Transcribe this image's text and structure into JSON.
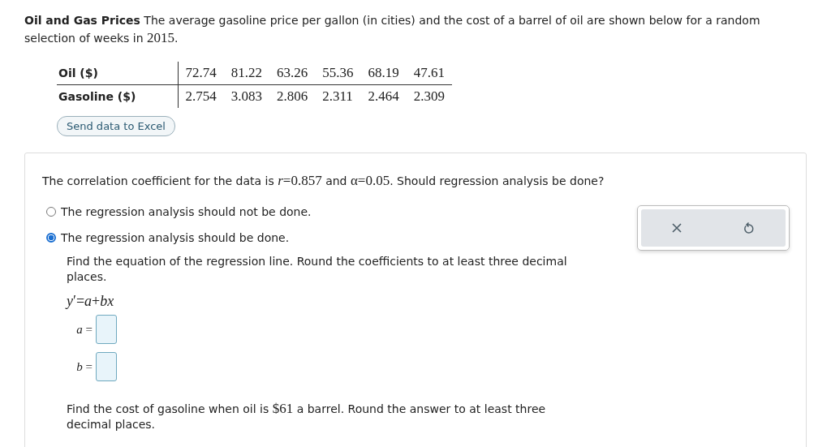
{
  "intro": [
    {
      "kind": "bold",
      "text": "Oil and Gas Prices"
    },
    {
      "kind": "text",
      "text": " The average gasoline price per gallon (in cities) and the cost of a barrel of oil are shown below for a random selection of weeks in "
    },
    {
      "kind": "math",
      "text": "2015"
    },
    {
      "kind": "text",
      "text": "."
    }
  ],
  "table": {
    "rows": [
      {
        "label": "Oil ($)",
        "values": [
          "72.74",
          "81.22",
          "63.26",
          "55.36",
          "68.19",
          "47.61"
        ]
      },
      {
        "label": "Gasoline ($)",
        "values": [
          "2.754",
          "3.083",
          "2.806",
          "2.311",
          "2.464",
          "2.309"
        ]
      }
    ]
  },
  "excel_button": "Send data to Excel",
  "question": [
    {
      "kind": "text",
      "text": "The correlation coefficient for the data is "
    },
    {
      "kind": "math",
      "text": "*r*=0.857"
    },
    {
      "kind": "text",
      "text": " and "
    },
    {
      "kind": "math",
      "text": "α=0.05"
    },
    {
      "kind": "text",
      "text": ". Should regression analysis be done?"
    }
  ],
  "options": [
    {
      "label": "The regression analysis should not be done.",
      "selected": false
    },
    {
      "label": "The regression analysis should be done.",
      "selected": true
    }
  ],
  "followup": {
    "instruction": [
      {
        "kind": "text",
        "text": "Find the equation of the regression line. Round the coefficients to at least three decimal places."
      }
    ],
    "equation": "*y*′=*a*+*bx*",
    "fields": [
      {
        "label": "*a* ="
      },
      {
        "label": "*b* ="
      }
    ]
  },
  "second_question": [
    {
      "kind": "text",
      "text": "Find the cost of gasoline when oil is "
    },
    {
      "kind": "math",
      "text": "$61"
    },
    {
      "kind": "text",
      "text": " a barrel. Round the answer to at least three decimal places."
    }
  ]
}
